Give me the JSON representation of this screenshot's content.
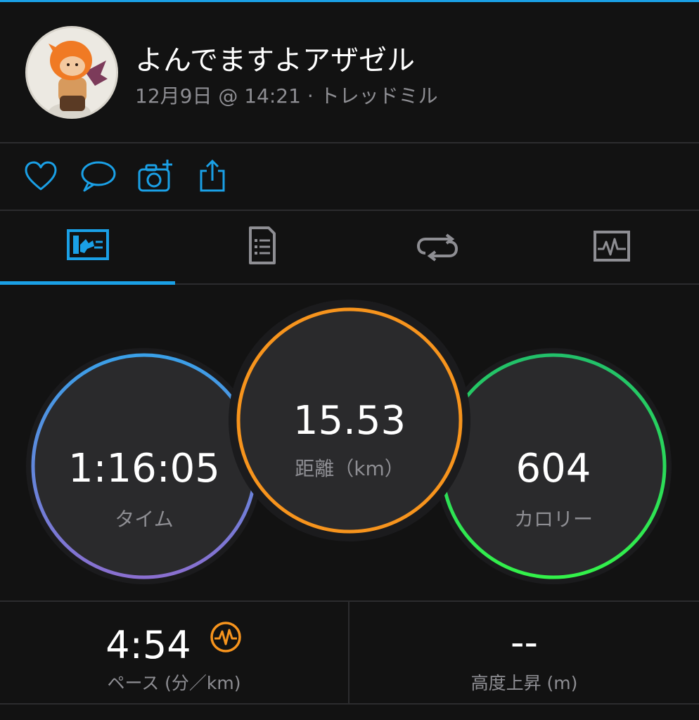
{
  "activity": {
    "title": "よんでますよアザゼル",
    "subtitle": "12月9日 @ 14:21 · トレッドミル"
  },
  "actions": [
    {
      "name": "like",
      "icon": "heart-icon"
    },
    {
      "name": "comment",
      "icon": "comment-icon"
    },
    {
      "name": "add-photo",
      "icon": "camera-plus-icon"
    },
    {
      "name": "share",
      "icon": "share-icon"
    }
  ],
  "tabs": [
    {
      "name": "overview",
      "icon": "summary-card-icon",
      "active": true
    },
    {
      "name": "details",
      "icon": "document-icon",
      "active": false
    },
    {
      "name": "laps",
      "icon": "repeat-icon",
      "active": false
    },
    {
      "name": "charts",
      "icon": "pulse-chart-icon",
      "active": false
    }
  ],
  "stats": {
    "time": {
      "value": "1:16:05",
      "label": "タイム"
    },
    "distance": {
      "value": "15.53",
      "label": "距離（km）"
    },
    "calories": {
      "value": "604",
      "label": "カロリー"
    }
  },
  "metrics": {
    "pace": {
      "value": "4:54",
      "label": "ペース (分／km)"
    },
    "elevation": {
      "value": "--",
      "label": "高度上昇 (m)"
    }
  },
  "colors": {
    "accent": "#1aa0e6",
    "background": "#121212",
    "distance_ring": "#f7941d",
    "calories_ring": "#2ef05a",
    "time_ring_start": "#3aa0e8",
    "time_ring_end": "#8a6fd0",
    "label_gray": "#8e8e93"
  }
}
